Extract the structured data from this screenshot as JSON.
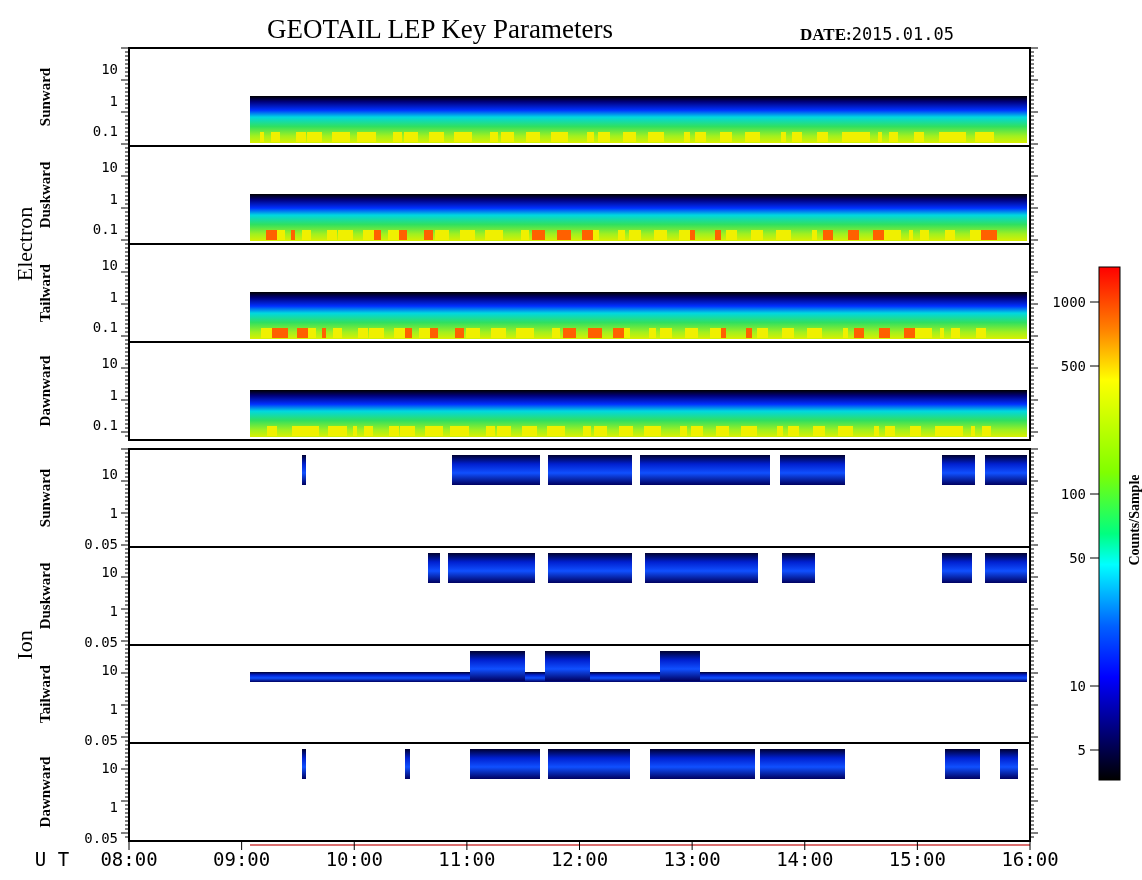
{
  "title": "GEOTAIL LEP Key Parameters",
  "date_label": "DATE:",
  "date": "2015.01.05",
  "groups": [
    {
      "label": "Electron",
      "kind": "electron",
      "panels": [
        {
          "label": "Sunward",
          "yticks": [
            "10",
            "1",
            "0.1"
          ]
        },
        {
          "label": "Duskward",
          "yticks": [
            "10",
            "1",
            "0.1"
          ]
        },
        {
          "label": "Tailward",
          "yticks": [
            "10",
            "1",
            "0.1"
          ]
        },
        {
          "label": "Dawnward",
          "yticks": [
            "10",
            "1",
            "0.1"
          ]
        }
      ]
    },
    {
      "label": "Ion",
      "kind": "ion",
      "panels": [
        {
          "label": "Sunward",
          "yticks": [
            "10",
            "1",
            "0.05"
          ]
        },
        {
          "label": "Duskward",
          "yticks": [
            "10",
            "1",
            "0.05"
          ]
        },
        {
          "label": "Tailward",
          "yticks": [
            "10",
            "1",
            "0.05"
          ]
        },
        {
          "label": "Dawnward",
          "yticks": [
            "10",
            "1",
            "0.05"
          ]
        }
      ]
    }
  ],
  "time_axis": {
    "label": "U T",
    "ticks": [
      "08:00",
      "09:00",
      "10:00",
      "11:00",
      "12:00",
      "13:00",
      "14:00",
      "15:00",
      "16:00"
    ]
  },
  "colorbar": {
    "label": "Counts/Sample",
    "ticks": [
      "1000",
      "500",
      "100",
      "50",
      "10",
      "5"
    ]
  }
}
